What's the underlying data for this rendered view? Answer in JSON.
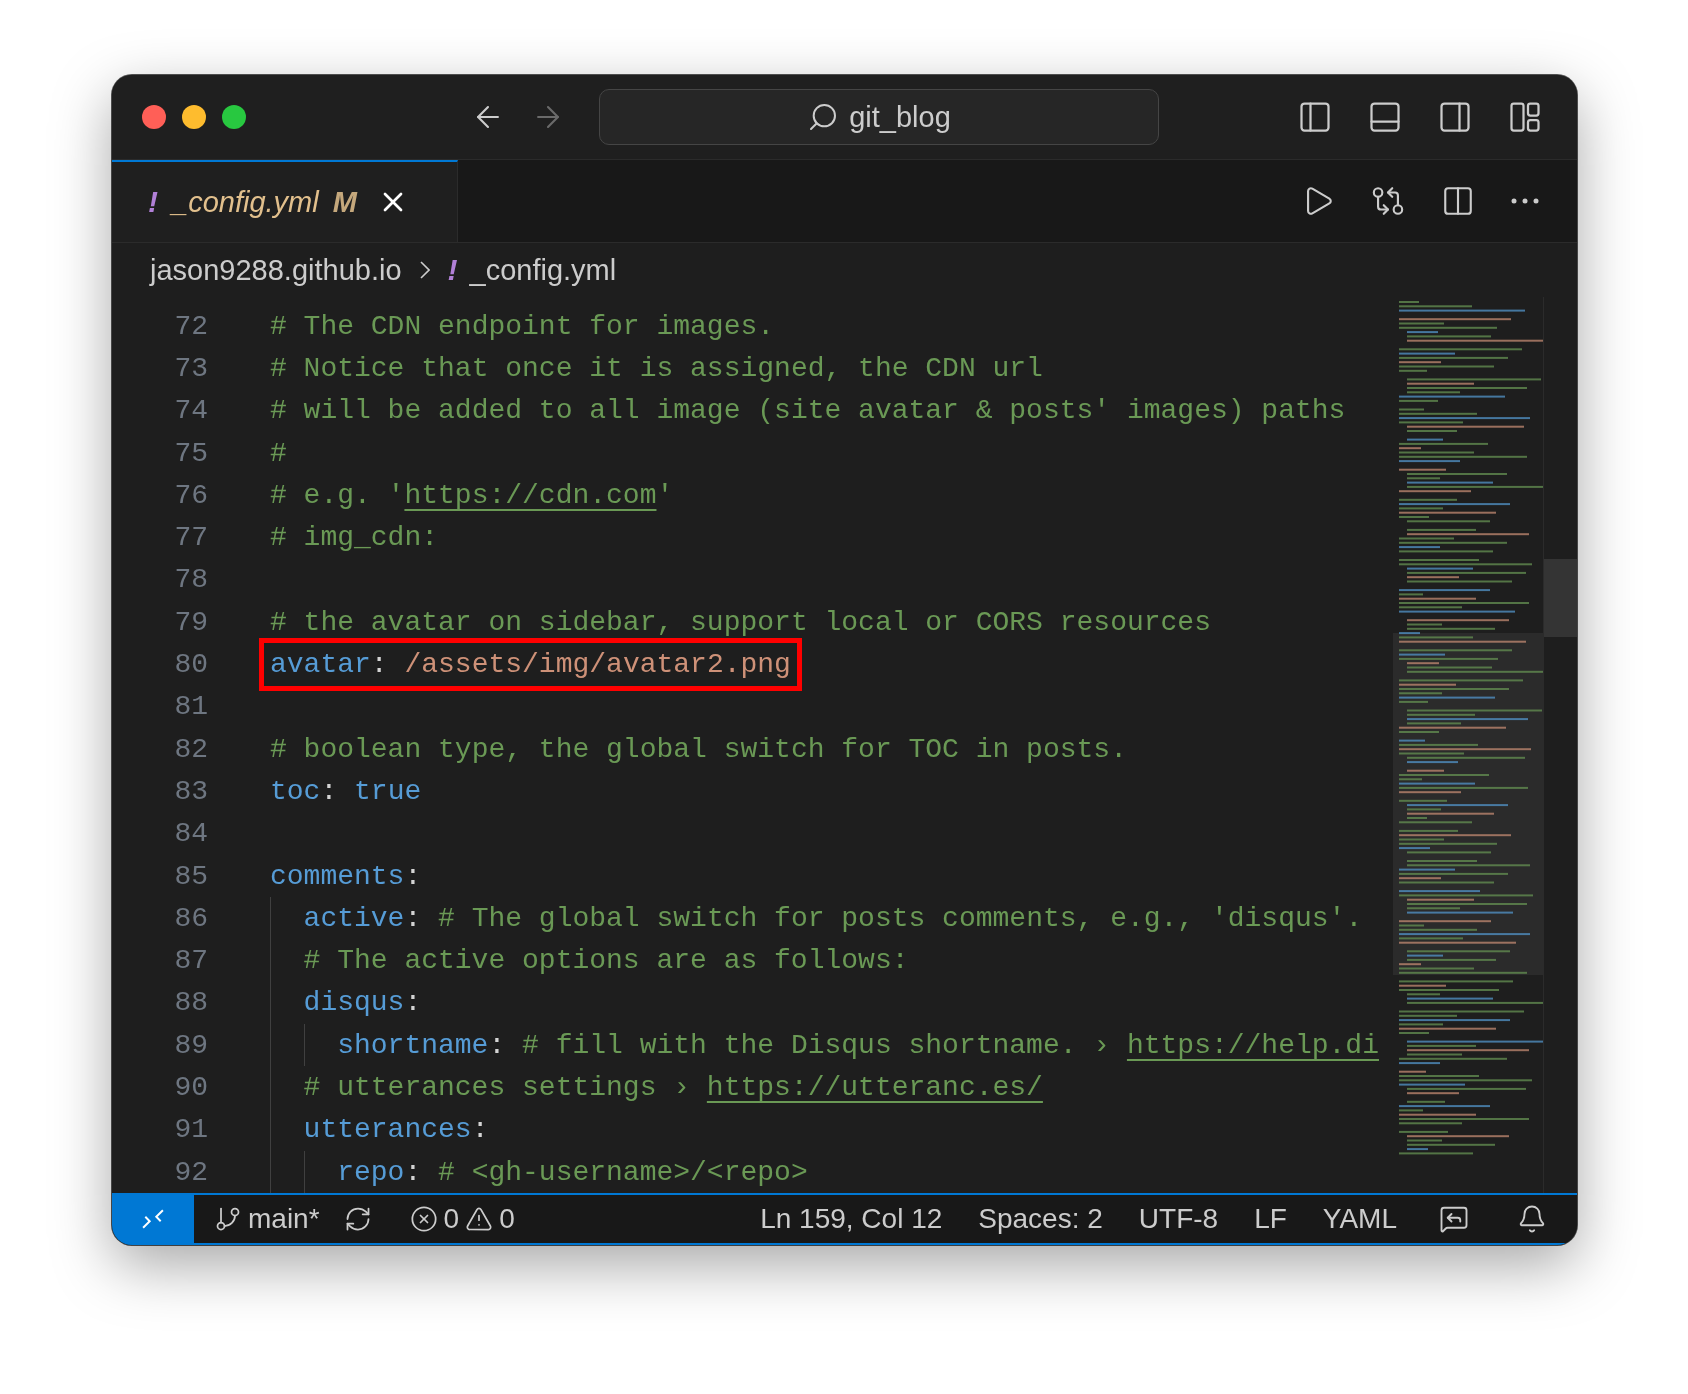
{
  "window": {
    "title": "git_blog"
  },
  "nav_buttons": [
    {
      "kind": "back",
      "disabled": false
    },
    {
      "kind": "forward",
      "disabled": true
    }
  ],
  "tabs": [
    {
      "icon_text": "!",
      "label": "_config.yml",
      "badge": "M",
      "selected": true
    }
  ],
  "breadcrumb": [
    {
      "label": "jason9288.github.io"
    },
    {
      "icon_text": "!",
      "label": "_config.yml"
    }
  ],
  "editor": {
    "lines": [
      {
        "number": "72",
        "highlighted": false,
        "tokens": [
          {
            "kind": "comment",
            "text": "# The CDN endpoint for images."
          }
        ]
      },
      {
        "number": "73",
        "highlighted": false,
        "tokens": [
          {
            "kind": "comment",
            "text": "# Notice that once it is assigned, the CDN url"
          }
        ]
      },
      {
        "number": "74",
        "highlighted": false,
        "tokens": [
          {
            "kind": "comment",
            "text": "# will be added to all image (site avatar & posts' images) paths"
          }
        ]
      },
      {
        "number": "75",
        "highlighted": false,
        "tokens": [
          {
            "kind": "comment",
            "text": "#"
          }
        ]
      },
      {
        "number": "76",
        "highlighted": false,
        "tokens": [
          {
            "kind": "comment",
            "text": "# e.g. '"
          },
          {
            "kind": "link",
            "text": "https://cdn.com"
          },
          {
            "kind": "comment",
            "text": "'"
          }
        ]
      },
      {
        "number": "77",
        "highlighted": false,
        "tokens": [
          {
            "kind": "comment",
            "text": "# img_cdn:"
          }
        ]
      },
      {
        "number": "78",
        "highlighted": false
      },
      {
        "number": "79",
        "highlighted": false,
        "tokens": [
          {
            "kind": "comment",
            "text": "# the avatar on sidebar, support local or CORS resources"
          }
        ]
      },
      {
        "number": "80",
        "highlighted": true,
        "tokens": [
          {
            "kind": "key",
            "text": "avatar"
          },
          {
            "kind": "punct",
            "text": ":"
          },
          {
            "kind": "string",
            "text": " /assets/img/avatar2.png"
          }
        ]
      },
      {
        "number": "81",
        "highlighted": false
      },
      {
        "number": "82",
        "highlighted": false,
        "tokens": [
          {
            "kind": "comment",
            "text": "# boolean type, the global switch for TOC in posts."
          }
        ]
      },
      {
        "number": "83",
        "highlighted": false,
        "tokens": [
          {
            "kind": "key",
            "text": "toc"
          },
          {
            "kind": "punct",
            "text": ":"
          },
          {
            "kind": "bool",
            "text": " true"
          }
        ]
      },
      {
        "number": "84",
        "highlighted": false
      },
      {
        "number": "85",
        "highlighted": false,
        "tokens": [
          {
            "kind": "key",
            "text": "comments"
          },
          {
            "kind": "punct",
            "text": ":"
          }
        ],
        "children": [
          {
            "number": "86",
            "highlighted": false,
            "tokens": [
              {
                "kind": "key",
                "text": "active"
              },
              {
                "kind": "punct",
                "text": ":"
              },
              {
                "kind": "comment",
                "text": " # The global switch for posts comments, e.g., 'disqus'."
              }
            ]
          },
          {
            "number": "87",
            "highlighted": false,
            "tokens": [
              {
                "kind": "comment",
                "text": "# The active options are as follows:"
              }
            ]
          },
          {
            "number": "88",
            "highlighted": false,
            "tokens": [
              {
                "kind": "key",
                "text": "disqus"
              },
              {
                "kind": "punct",
                "text": ":"
              }
            ],
            "children": [
              {
                "number": "89",
                "highlighted": false,
                "tokens": [
                  {
                    "kind": "key",
                    "text": "shortname"
                  },
                  {
                    "kind": "punct",
                    "text": ":"
                  },
                  {
                    "kind": "comment",
                    "text": " # fill with the Disqus shortname. › "
                  },
                  {
                    "kind": "link",
                    "text": "https://help.di"
                  }
                ]
              }
            ]
          },
          {
            "number": "90",
            "highlighted": false,
            "tokens": [
              {
                "kind": "comment",
                "text": "# utterances settings › "
              },
              {
                "kind": "link",
                "text": "https://utteranc.es/"
              }
            ]
          },
          {
            "number": "91",
            "highlighted": false,
            "tokens": [
              {
                "kind": "key",
                "text": "utterances"
              },
              {
                "kind": "punct",
                "text": ":"
              }
            ],
            "children": [
              {
                "number": "92",
                "highlighted": false,
                "tokens": [
                  {
                    "kind": "key",
                    "text": "repo"
                  },
                  {
                    "kind": "punct",
                    "text": ":"
                  },
                  {
                    "kind": "comment",
                    "text": " # <gh-username>/<repo>"
                  }
                ]
              }
            ]
          }
        ]
      }
    ]
  },
  "status_bar": {
    "branch": "main*",
    "errors": "0",
    "warnings": "0",
    "items": [
      "Ln 159, Col 12",
      "Spaces: 2",
      "UTF-8",
      "LF",
      "YAML"
    ]
  }
}
